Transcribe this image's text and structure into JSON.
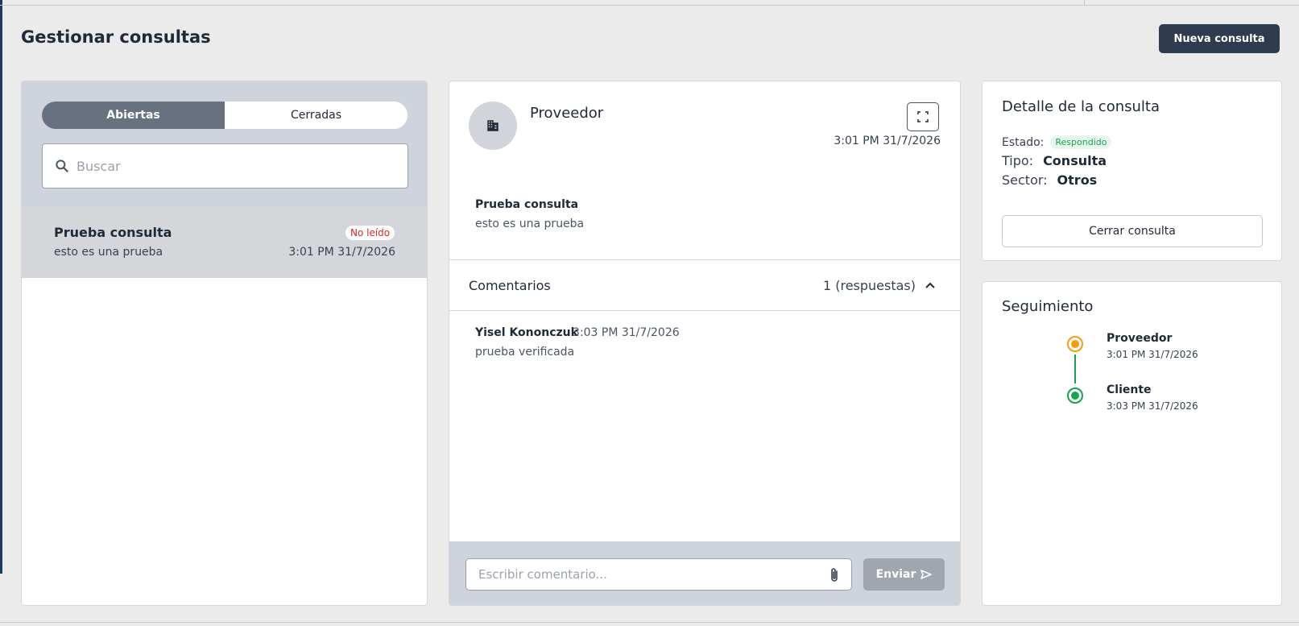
{
  "header": {
    "title": "Gestionar consultas",
    "new_button_label": "Nueva consulta"
  },
  "sidebar": {
    "tabs": [
      {
        "label": "Abiertas",
        "active": true
      },
      {
        "label": "Cerradas",
        "active": false
      }
    ],
    "search": {
      "placeholder": "Buscar",
      "value": "",
      "icon": "search-icon"
    },
    "items": [
      {
        "title": "Prueba consulta",
        "subtitle": "esto es una prueba",
        "badge": "No leído",
        "date": "3:01 PM 31/7/2026"
      }
    ]
  },
  "thread": {
    "sender": "Proveedor",
    "avatar_icon": "building-icon",
    "expand_icon": "expand-icon",
    "date": "3:01 PM 31/7/2026",
    "message": {
      "title": "Prueba consulta",
      "body": "esto es una prueba"
    },
    "comments": {
      "label": "Comentarios",
      "count_text": "1 (respuestas)",
      "toggle_icon": "chevron-up-icon",
      "items": [
        {
          "author": "Yisel Kononczuk",
          "date": "3:03 PM 31/7/2026",
          "body": "prueba verificada"
        }
      ]
    },
    "composer": {
      "placeholder": "Escribir comentario...",
      "value": "",
      "attach_icon": "paperclip-icon",
      "send_label": "Enviar",
      "send_icon": "send-icon"
    }
  },
  "detail": {
    "title": "Detalle de la consulta",
    "estado_label": "Estado:",
    "estado_value": "Respondido",
    "tipo_label": "Tipo:",
    "tipo_value": "Consulta",
    "sector_label": "Sector:",
    "sector_value": "Otros",
    "close_button_label": "Cerrar consulta"
  },
  "tracking": {
    "title": "Seguimiento",
    "steps": [
      {
        "name": "Proveedor",
        "date": "3:01 PM 31/7/2026",
        "color": "#f59e0b"
      },
      {
        "name": "Cliente",
        "date": "3:03 PM 31/7/2026",
        "color": "#16a34a"
      }
    ]
  },
  "colors": {
    "accent_dark": "#2f3b4f",
    "tab_active": "#67717f",
    "unread_badge": "#dc2626",
    "status_green": "#16a34a",
    "step_orange": "#f59e0b"
  }
}
